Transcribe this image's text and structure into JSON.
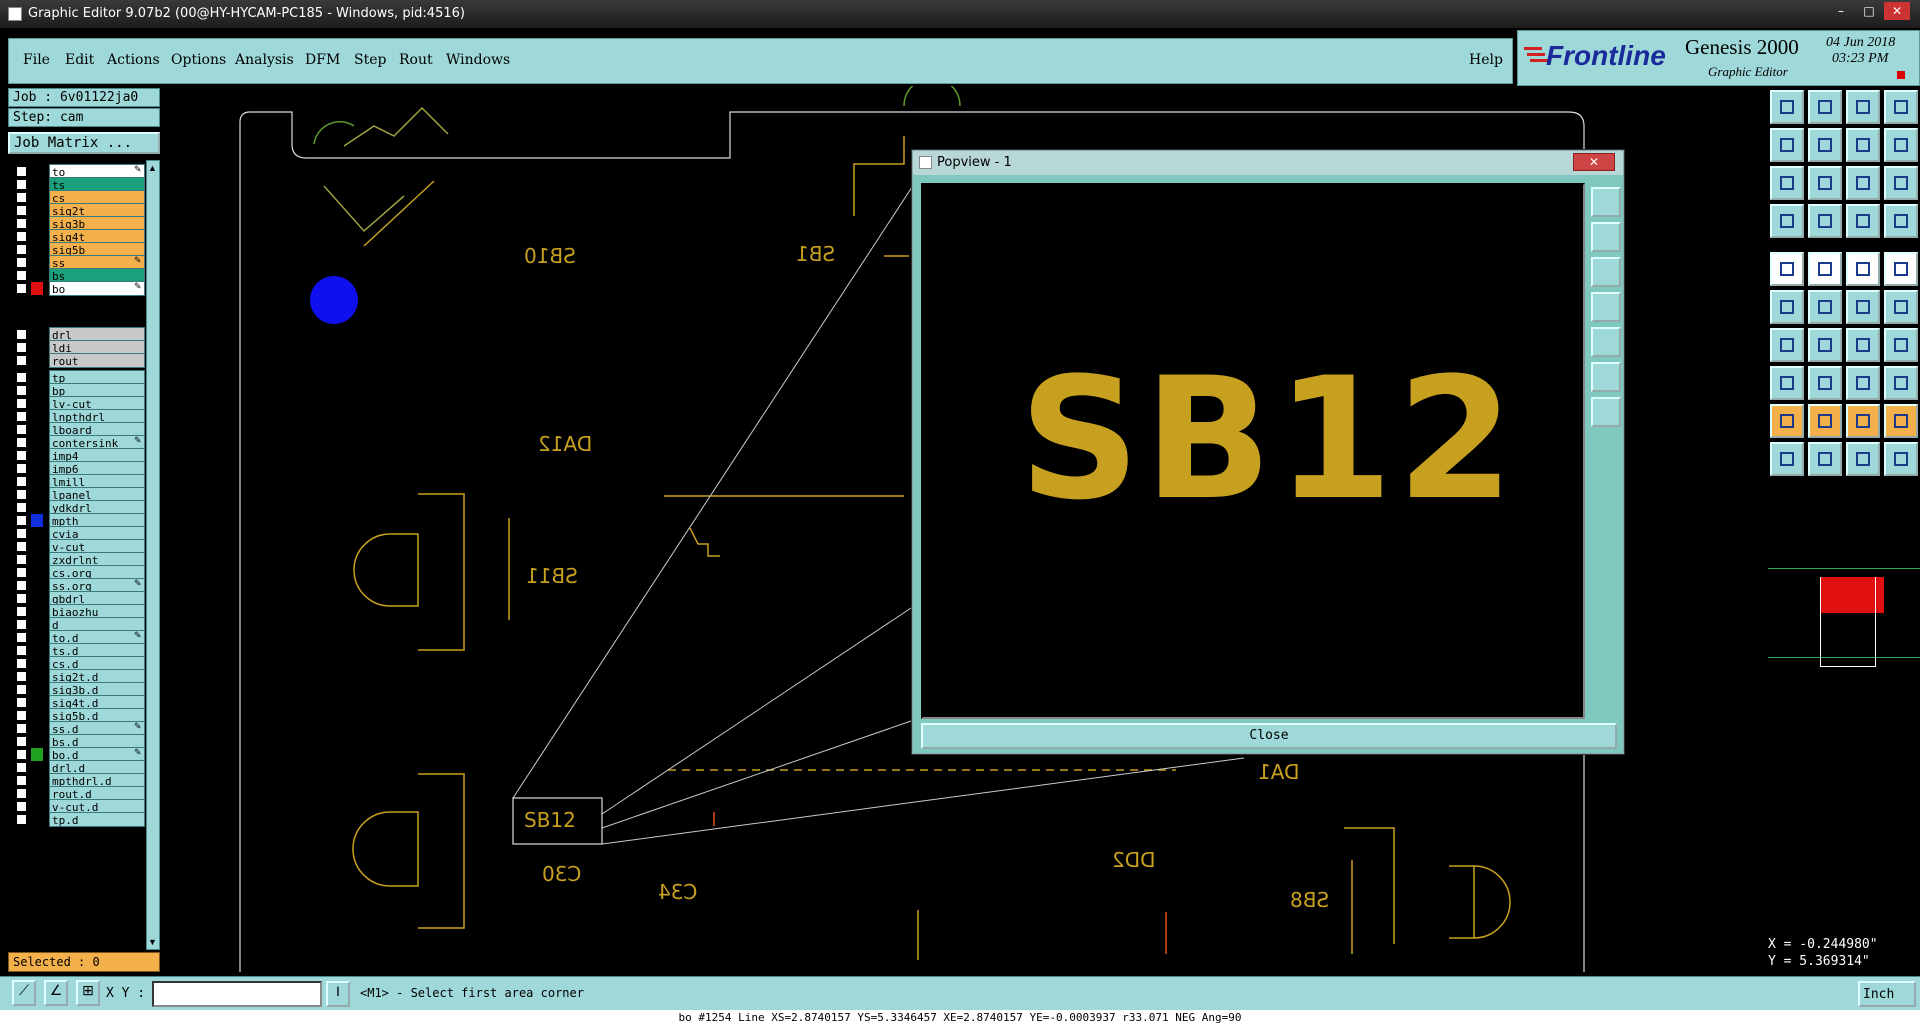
{
  "window": {
    "title": "Graphic Editor 9.07b2 (00@HY-HYCAM-PC185 - Windows, pid:4516)",
    "minimize": "–",
    "maximize": "□",
    "close": "✕"
  },
  "menu": {
    "items": [
      "File",
      "Edit",
      "Actions",
      "Options",
      "Analysis",
      "DFM",
      "Step",
      "Rout",
      "Windows"
    ],
    "help": "Help"
  },
  "logo": {
    "brand": "Frontline",
    "product": "Genesis 2000",
    "subtitle": "Graphic Editor",
    "date": "04 Jun 2018",
    "time": "03:23 PM"
  },
  "job": {
    "job_label": "Job : 6v01122ja0",
    "step_label": "Step: cam",
    "matrix_button": "Job Matrix ..."
  },
  "layers": {
    "group1": [
      {
        "name": "to",
        "color": "#ffffff",
        "icon": "pen-icon"
      },
      {
        "name": "ts",
        "color": "#1aa07a"
      },
      {
        "name": "cs",
        "color": "#f4b04a"
      },
      {
        "name": "sig2t",
        "color": "#f4b04a"
      },
      {
        "name": "sig3b",
        "color": "#f4b04a"
      },
      {
        "name": "sig4t",
        "color": "#f4b04a"
      },
      {
        "name": "sig5b",
        "color": "#f4b04a"
      },
      {
        "name": "ss",
        "color": "#f4b04a",
        "icon": "pen-icon"
      },
      {
        "name": "bs",
        "color": "#1aa07a"
      },
      {
        "name": "bo",
        "color": "#ffffff",
        "icon": "pen-icon",
        "swatch": "#e01010"
      }
    ],
    "group2": [
      {
        "name": "drl",
        "color": "#c8c8c8"
      },
      {
        "name": "ldi",
        "color": "#c8c8c8"
      },
      {
        "name": "rout",
        "color": "#c8c8c8"
      }
    ],
    "group3": [
      {
        "name": "tp"
      },
      {
        "name": "bp"
      },
      {
        "name": "lv-cut"
      },
      {
        "name": "lnpthdrl"
      },
      {
        "name": "lboard"
      },
      {
        "name": "contersink",
        "icon": "pen-icon"
      },
      {
        "name": "imp4"
      },
      {
        "name": "imp6"
      },
      {
        "name": "lmill"
      },
      {
        "name": "lpanel"
      },
      {
        "name": "ydkdrl"
      },
      {
        "name": "mpth",
        "swatch": "#1030e0"
      },
      {
        "name": "cvia"
      },
      {
        "name": "v-cut"
      },
      {
        "name": "zxdrlnt"
      },
      {
        "name": "cs.org"
      },
      {
        "name": "ss.org",
        "icon": "pen-icon"
      },
      {
        "name": "gbdrl"
      },
      {
        "name": "biaozhu"
      },
      {
        "name": "d"
      },
      {
        "name": "to.d",
        "icon": "pen-icon"
      },
      {
        "name": "ts.d"
      },
      {
        "name": "cs.d"
      },
      {
        "name": "sig2t.d"
      },
      {
        "name": "sig3b.d"
      },
      {
        "name": "sig4t.d"
      },
      {
        "name": "sig5b.d"
      },
      {
        "name": "ss.d",
        "icon": "pen-icon"
      },
      {
        "name": "bs.d"
      },
      {
        "name": "bo.d",
        "swatch": "#20a020",
        "icon": "pen-icon"
      },
      {
        "name": "drl.d"
      },
      {
        "name": "mpthdrl.d"
      },
      {
        "name": "rout.d"
      },
      {
        "name": "v-cut.d"
      },
      {
        "name": "tp.d"
      }
    ]
  },
  "selected": "Selected : 0",
  "canvas": {
    "labels": [
      "SB10",
      "SB1",
      "DA12",
      "SB11",
      "SB12",
      "C30",
      "C34",
      "DD2",
      "SB8",
      "DA1"
    ]
  },
  "popview": {
    "title": "Popview - 1",
    "content": "SB12",
    "close_label": "Close"
  },
  "bottom": {
    "xy_label": "X Y :",
    "prompt": "<M1> - Select first area corner",
    "units": "Inch"
  },
  "coords": {
    "x": "X = -0.244980\"",
    "y": "Y = 5.369314\""
  },
  "status": "bo #1254 Line XS=2.8740157 YS=5.3346457 XE=2.8740157 YE=-0.0003937 r33.071 NEG Ang=90",
  "colors": {
    "trace": "#c8a020",
    "panel": "#9ed8d8",
    "accent": "#f4b04a"
  }
}
